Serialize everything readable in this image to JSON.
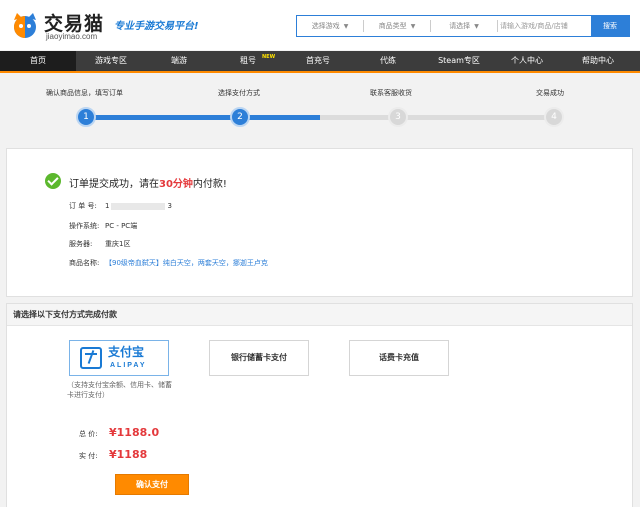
{
  "header": {
    "logo_text": "交易猫",
    "logo_domain": "jiaoyimao.com",
    "slogan": "专业手游交易平台!",
    "search": {
      "game_select": "选择游戏",
      "type_select": "商品类型",
      "choose_select": "请选择",
      "keyword_placeholder": "请输入游戏/商品/店铺",
      "search_button": "搜索"
    }
  },
  "nav": {
    "items": [
      "首页",
      "游戏专区",
      "端游",
      "租号",
      "首充号",
      "代练",
      "Steam专区",
      "个人中心",
      "帮助中心"
    ],
    "new_badge": "NEW"
  },
  "steps": {
    "labels": [
      "确认商品信息，填写订单",
      "选择支付方式",
      "联系客服收货",
      "交易成功"
    ],
    "numbers": [
      "1",
      "2",
      "3",
      "4"
    ],
    "current": 2
  },
  "order": {
    "title_prefix": "订单提交成功，请在",
    "time_limit": "30分钟",
    "title_suffix": "内付款!",
    "order_no_label": "订 单 号:",
    "order_no_start": "1",
    "order_no_end": "3",
    "os_label": "操作系统:",
    "os_value": "PC - PC端",
    "server_label": "服务器:",
    "server_value": "重庆1区",
    "product_label": "商品名称:",
    "product_value": "【90级帝血弑天】纯白天空，两套天空，挪迦王卢克"
  },
  "payment": {
    "heading": "请选择以下支付方式完成付款",
    "alipay_cn": "支付宝",
    "alipay_en": "ALIPAY",
    "alipay_note": "（支持支付宝余额、信用卡、储蓄卡进行支付）",
    "bank_label": "银行储蓄卡支付",
    "phone_label": "话费卡充值",
    "total_label": "总  价:",
    "total_value": "¥1188.0",
    "paid_label": "实  付:",
    "paid_value": "¥1188",
    "confirm_button": "确认支付"
  },
  "colors": {
    "brand_blue": "#2d7fd8",
    "accent_orange": "#ff8a00",
    "price_red": "#e4393c",
    "success_green": "#5cb82e"
  }
}
